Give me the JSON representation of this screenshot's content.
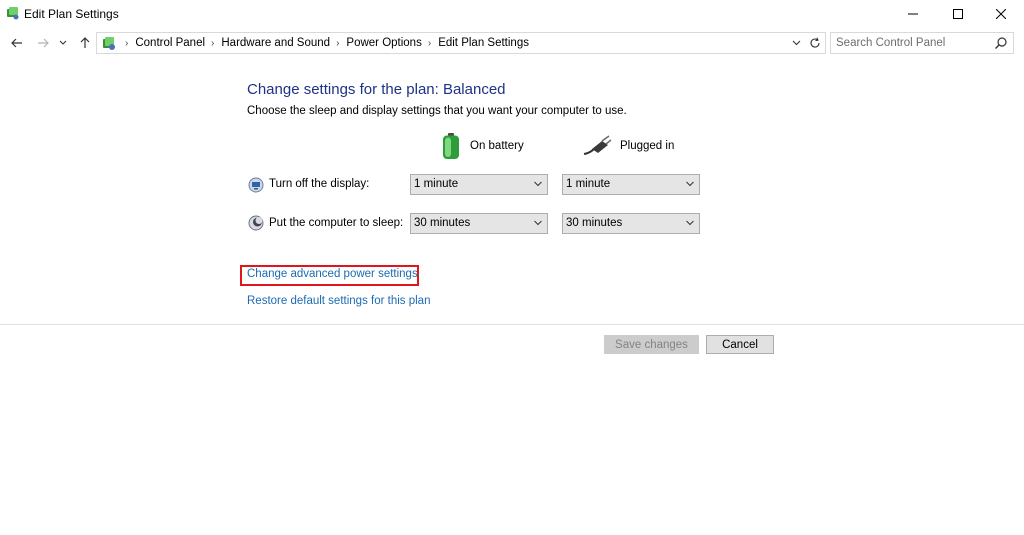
{
  "window": {
    "title": "Edit Plan Settings",
    "buttons": {
      "minimize": "minimize",
      "maximize": "maximize",
      "close": "close"
    }
  },
  "navigation": {
    "breadcrumbs": [
      "Control Panel",
      "Hardware and Sound",
      "Power Options",
      "Edit Plan Settings"
    ],
    "search_placeholder": "Search Control Panel"
  },
  "plan": {
    "heading": "Change settings for the plan: Balanced",
    "description": "Choose the sleep and display settings that you want your computer to use.",
    "columns": {
      "battery": "On battery",
      "plugged": "Plugged in"
    },
    "rows": [
      {
        "label": "Turn off the display:",
        "battery": "1 minute",
        "plugged": "1 minute",
        "icon": "display-icon"
      },
      {
        "label": "Put the computer to sleep:",
        "battery": "30 minutes",
        "plugged": "30 minutes",
        "icon": "sleep-icon"
      }
    ],
    "links": {
      "advanced": "Change advanced power settings",
      "restore": "Restore default settings for this plan"
    }
  },
  "footer": {
    "save": "Save changes",
    "cancel": "Cancel"
  },
  "colors": {
    "heading": "#1e3287",
    "link": "#1c6bb0",
    "highlight": "#e0161d",
    "battery": "#3cb84a"
  }
}
